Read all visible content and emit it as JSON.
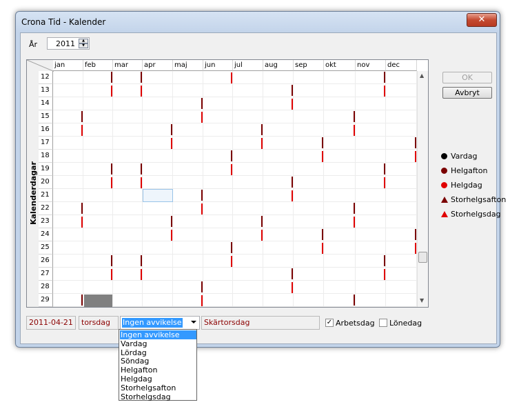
{
  "window": {
    "title": "Crona Tid - Kalender",
    "close_glyph": "✕"
  },
  "year": {
    "label": "År",
    "value": "2011"
  },
  "calendar": {
    "vertical_label": "Kalenderdagar",
    "months": [
      "jan",
      "feb",
      "mar",
      "apr",
      "maj",
      "jun",
      "jul",
      "aug",
      "sep",
      "okt",
      "nov",
      "dec"
    ],
    "days": [
      "12",
      "13",
      "14",
      "15",
      "16",
      "17",
      "18",
      "19",
      "20",
      "21",
      "22",
      "23",
      "24",
      "25",
      "26",
      "27",
      "28",
      "29"
    ]
  },
  "buttons": {
    "ok": "OK",
    "cancel": "Avbryt"
  },
  "legend": [
    {
      "label": "Vardag",
      "color": "#000000",
      "shape": "circle"
    },
    {
      "label": "Helgafton",
      "color": "#7a0000",
      "shape": "circle"
    },
    {
      "label": "Helgdag",
      "color": "#e00000",
      "shape": "circle"
    },
    {
      "label": "Storhelgsafton",
      "color": "#7a0000",
      "shape": "triangle"
    },
    {
      "label": "Storhelgsdag",
      "color": "#e00000",
      "shape": "triangle"
    }
  ],
  "status": {
    "date": "2011-04-21",
    "weekday": "torsdag",
    "deviation": "Ingen avvikelse",
    "holiday_name": "Skärtorsdag",
    "workday_label": "Arbetsdag",
    "workday_checked": true,
    "payday_label": "Lönedag",
    "payday_checked": false
  },
  "dropdown_options": [
    "Ingen avvikelse",
    "Vardag",
    "Lördag",
    "Söndag",
    "Helgafton",
    "Helgdag",
    "Storhelgsafton",
    "Storhelgsdag"
  ],
  "dropdown_selected": 0
}
